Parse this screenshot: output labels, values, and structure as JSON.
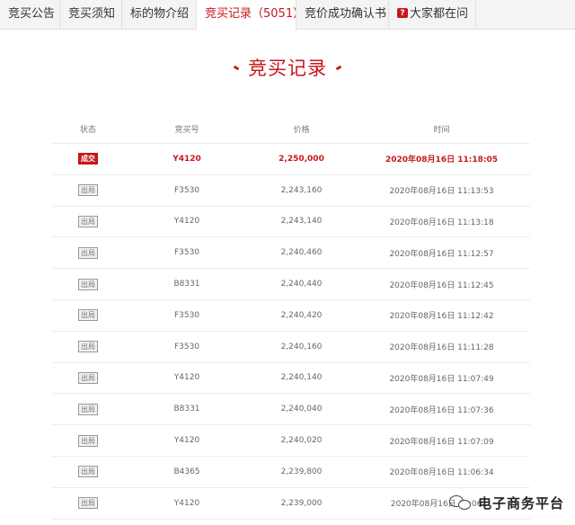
{
  "tabs": [
    {
      "label": "竞买公告",
      "active": false
    },
    {
      "label": "竞买须知",
      "active": false
    },
    {
      "label": "标的物介绍",
      "active": false
    },
    {
      "label": "竞买记录（5051）",
      "active": true
    },
    {
      "label": "竞价成功确认书",
      "active": false
    },
    {
      "label": "大家都在问",
      "active": false,
      "icon": "question-bubble-icon"
    }
  ],
  "section_title": "竞买记录",
  "table": {
    "headers": [
      "状态",
      "竞买号",
      "价格",
      "时间"
    ],
    "rows": [
      {
        "status": "成交",
        "bidder": "Y4120",
        "price": "2,250,000",
        "time": "2020年08月16日 11:18:05",
        "winner": true
      },
      {
        "status": "出局",
        "bidder": "F3530",
        "price": "2,243,160",
        "time": "2020年08月16日 11:13:53",
        "winner": false
      },
      {
        "status": "出局",
        "bidder": "Y4120",
        "price": "2,243,140",
        "time": "2020年08月16日 11:13:18",
        "winner": false
      },
      {
        "status": "出局",
        "bidder": "F3530",
        "price": "2,240,460",
        "time": "2020年08月16日 11:12:57",
        "winner": false
      },
      {
        "status": "出局",
        "bidder": "B8331",
        "price": "2,240,440",
        "time": "2020年08月16日 11:12:45",
        "winner": false
      },
      {
        "status": "出局",
        "bidder": "F3530",
        "price": "2,240,420",
        "time": "2020年08月16日 11:12:42",
        "winner": false
      },
      {
        "status": "出局",
        "bidder": "F3530",
        "price": "2,240,160",
        "time": "2020年08月16日 11:11:28",
        "winner": false
      },
      {
        "status": "出局",
        "bidder": "Y4120",
        "price": "2,240,140",
        "time": "2020年08月16日 11:07:49",
        "winner": false
      },
      {
        "status": "出局",
        "bidder": "B8331",
        "price": "2,240,040",
        "time": "2020年08月16日 11:07:36",
        "winner": false
      },
      {
        "status": "出局",
        "bidder": "Y4120",
        "price": "2,240,020",
        "time": "2020年08月16日 11:07:09",
        "winner": false
      },
      {
        "status": "出局",
        "bidder": "B4365",
        "price": "2,239,800",
        "time": "2020年08月16日 11:06:34",
        "winner": false
      },
      {
        "status": "出局",
        "bidder": "Y4120",
        "price": "2,239,000",
        "time": "2020年08月16日 11:06:...",
        "winner": false
      }
    ]
  },
  "watermark": {
    "text": "电子商务平台",
    "icon": "wechat-icon"
  },
  "colors": {
    "accent": "#c8161d",
    "tab_bar": "#f4f4f4"
  }
}
